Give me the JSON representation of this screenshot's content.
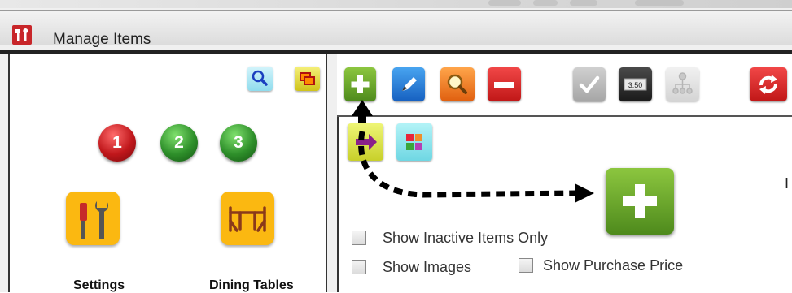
{
  "window": {
    "title": "Manage Items",
    "truncated_text": "I"
  },
  "left_panel": {
    "top_icons": [
      "search-icon",
      "layers-icon"
    ],
    "pages": [
      "1",
      "2",
      "3"
    ],
    "tiles": [
      {
        "label": "Settings",
        "icon": "tools-icon"
      },
      {
        "label": "Dining Tables",
        "icon": "dining-table-icon"
      }
    ]
  },
  "toolbar": {
    "buttons": [
      "add-icon",
      "edit-icon",
      "search-icon",
      "remove-icon",
      "check-icon",
      "price-icon",
      "hierarchy-icon",
      "sync-icon"
    ],
    "price_text": "3.50"
  },
  "filters": {
    "show_inactive": "Show Inactive Items Only",
    "show_images": "Show Images",
    "show_purchase_price": "Show Purchase Price"
  },
  "colors": {
    "add_green": "#6aa532",
    "edit_blue": "#1f7fd6",
    "search_orange": "#f07e1e",
    "remove_red": "#d92626",
    "accent_yellow": "#fbb811",
    "sync_red": "#d8262b"
  }
}
